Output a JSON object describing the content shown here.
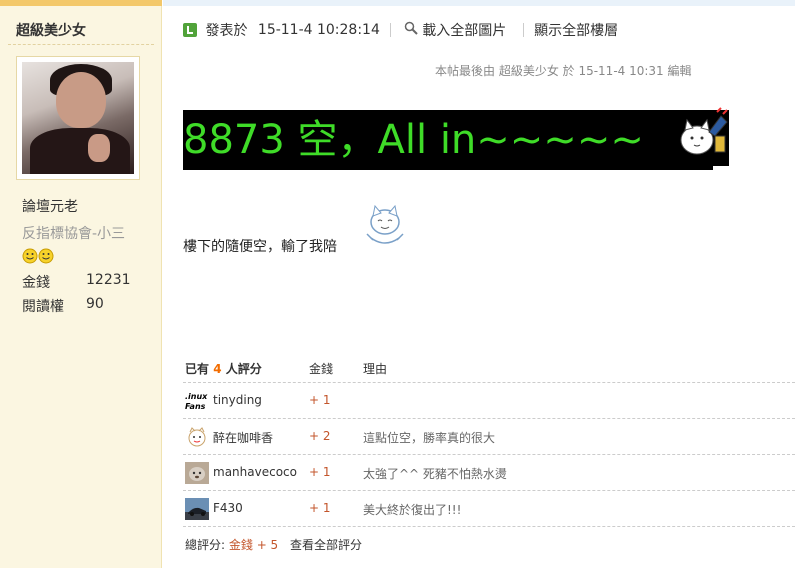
{
  "author": {
    "name": "超級美少女",
    "rank": "論壇元老",
    "group": "反指標協會-小三",
    "stats": [
      {
        "label": "金錢",
        "value": "12231"
      },
      {
        "label": "閱讀權",
        "value": "90"
      }
    ]
  },
  "post": {
    "posted_label": "發表於",
    "posted_time": "15-11-4 10:28:14",
    "load_images": "載入全部圖片",
    "show_all_floors": "顯示全部樓層",
    "edited_note": "本帖最後由 超級美少女 於 15-11-4 10:31 編輯",
    "headline": "8873 空，All in~~~~~",
    "body": "樓下的隨便空，輸了我陪"
  },
  "rating": {
    "summary_prefix": "已有",
    "count": "4",
    "summary_suffix": "人評分",
    "col_gold": "金錢",
    "col_reason": "理由",
    "rows": [
      {
        "user": "tinyding",
        "score": "+ 1",
        "reason": ""
      },
      {
        "user": "醉在咖啡香",
        "score": "+ 2",
        "reason": "這點位空，勝率真的很大"
      },
      {
        "user": "manhavecoco",
        "score": "+ 1",
        "reason": "太強了^^ 死豬不怕熱水燙"
      },
      {
        "user": "F430",
        "score": "+ 1",
        "reason": "美大終於復出了!!!"
      }
    ],
    "total_label": "總評分:",
    "total_value": "金錢 + 5",
    "view_all": "查看全部評分"
  },
  "colors": {
    "headline_text": "#3fdc28",
    "headline_bg": "#000000",
    "score": "#c3552b",
    "count": "#f26c00"
  },
  "icons": [
    "post-icon",
    "zoom-icon",
    "smiley-icon",
    "cat-emoji"
  ]
}
